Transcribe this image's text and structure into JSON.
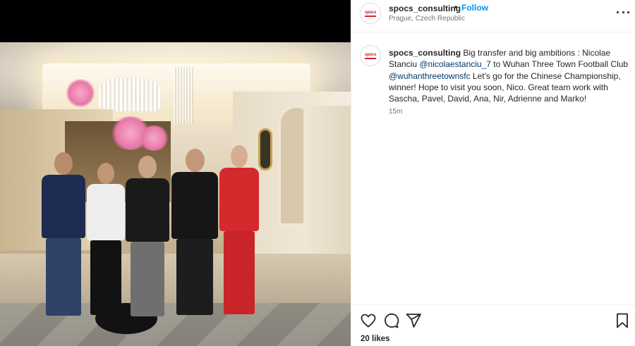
{
  "post": {
    "username": "spocs_consulting",
    "location": "Prague, Czech Republic",
    "follow_label": "Follow",
    "header_separator": "•",
    "avatar_logo_text": "spocs",
    "caption": {
      "username": "spocs_consulting",
      "text_1": " Big transfer and big ambitions : Nicolae Stanciu ",
      "mention_1": "@nicolaestanciu_7",
      "text_2": " to Wuhan Three Town Football Club ",
      "mention_2": "@wuhanthreetownsfc",
      "text_3": " Let's go for the Chinese Championship, winner! Hope to visit you soon, Nico. Great team work with Sascha, Pavel, David, Ana, Nir, Adrienne and Marko!"
    },
    "time_ago": "15m",
    "likes_text": "20 likes"
  },
  "icons": {
    "more": "more-options-icon",
    "like": "heart-icon",
    "comment": "comment-icon",
    "share": "share-icon",
    "save": "bookmark-icon"
  },
  "colors": {
    "follow_blue": "#0095f6",
    "mention_blue": "#00376b",
    "logo_red": "#d9232e",
    "muted_text": "#737373"
  }
}
